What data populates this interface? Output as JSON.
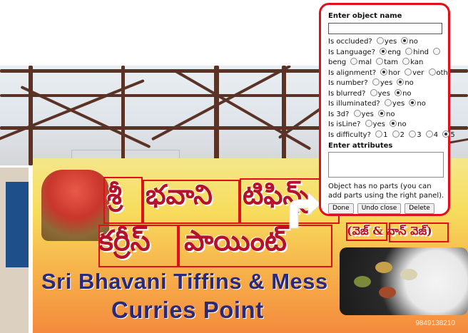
{
  "sign": {
    "telugu_line1": "శ్రీభవాని టిఫిన్స్",
    "telugu_line1_part_a": "శ్రీ",
    "telugu_line1_part_b": "భవాని",
    "telugu_line1_part_c": "టిఫిన్స్",
    "telugu_line2_part_a": "కర్రీస్",
    "telugu_line2_part_b": "పాయింట్",
    "veg_label": "(వెజ్ & నాన్ వెజ్)",
    "english_line1": "Sri Bhavani Tiffins & Mess",
    "english_line2": "Curries Point",
    "credit": "9849138210"
  },
  "dialog": {
    "title": "Enter object name",
    "name_value": "",
    "attributes_title": "Enter attributes",
    "attributes_value": "",
    "parts_note": "Object has no parts (you can add parts using the right panel).",
    "buttons": {
      "done": "Done",
      "undo": "Undo close",
      "delete": "Delete"
    },
    "questions": {
      "occluded": {
        "label": "Is occluded?",
        "opts": [
          "yes",
          "no"
        ],
        "selected": "no"
      },
      "language": {
        "label": "Is Language?",
        "opts": [
          "eng",
          "hind",
          "beng",
          "mal",
          "tam",
          "kan"
        ],
        "selected": "eng"
      },
      "alignment": {
        "label": "Is alignment?",
        "opts": [
          "hor",
          "ver",
          "oth"
        ],
        "selected": "hor"
      },
      "number": {
        "label": "Is number?",
        "opts": [
          "yes",
          "no"
        ],
        "selected": "no"
      },
      "blurred": {
        "label": "Is blurred?",
        "opts": [
          "yes",
          "no"
        ],
        "selected": "no"
      },
      "illuminated": {
        "label": "Is illuminated?",
        "opts": [
          "yes",
          "no"
        ],
        "selected": "no"
      },
      "three_d": {
        "label": "Is 3d?",
        "opts": [
          "yes",
          "no"
        ],
        "selected": "no"
      },
      "is_line": {
        "label": "Is isLine?",
        "opts": [
          "yes",
          "no"
        ],
        "selected": "no"
      },
      "difficulty": {
        "label": "Is difficulty?",
        "opts": [
          "1",
          "2",
          "3",
          "4",
          "5"
        ],
        "selected": "5"
      }
    }
  },
  "colors": {
    "annotation_red": "#e0101a",
    "board_text_red": "#b3122a",
    "board_text_blue": "#2b2a7a"
  }
}
